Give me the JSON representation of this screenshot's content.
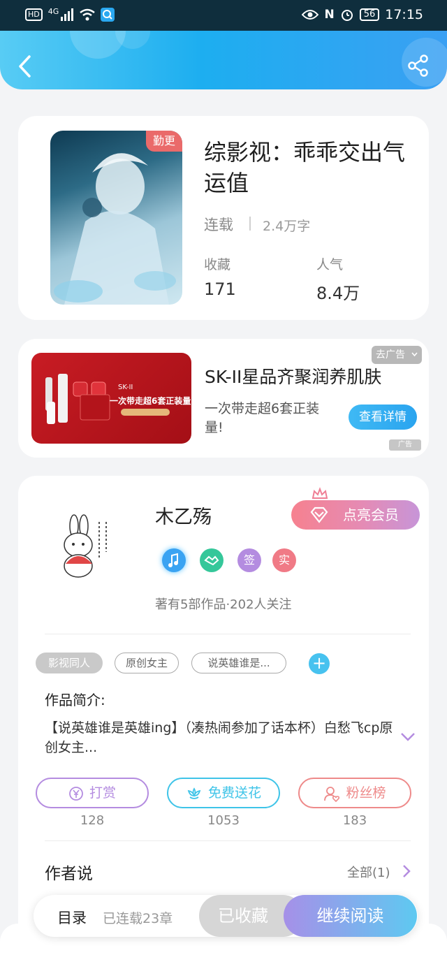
{
  "status_bar": {
    "hd": "HD",
    "net": "4G",
    "battery": "56",
    "time": "17:15"
  },
  "book": {
    "tag": "勤更",
    "title": "综影视：乖乖交出气运值",
    "status": "连载",
    "words": "2.4万字",
    "stats": [
      {
        "label": "收藏",
        "value": "171"
      },
      {
        "label": "人气",
        "value": "8.4万"
      }
    ]
  },
  "ad": {
    "title": "SK-II星品齐聚润养肌肤",
    "desc": "一次带走超6套正装量!",
    "button": "查看详情",
    "close_label": "去广告",
    "ad_mark": "广告",
    "image_logo": "SK-II",
    "image_headline": "一次带走超6套正装量"
  },
  "author": {
    "name": "木乙殇",
    "vip_button": "点亮会员",
    "badges": [
      {
        "icon": "music-note-icon",
        "color": "#3aa3f2"
      },
      {
        "icon": "handshake-icon",
        "color": "#35c79a"
      },
      {
        "label": "签",
        "color": "#b48ce0"
      },
      {
        "label": "实",
        "color": "#f07a86"
      }
    ],
    "works": "著有5部作品·202人关注"
  },
  "tags": [
    "影视同人",
    "原创女主",
    "说英雄谁是..."
  ],
  "intro": {
    "title": "作品简介:",
    "text": "【说英雄谁是英雄ing】（凑热闹参加了话本杯）白愁飞cp原创女主..."
  },
  "actions": [
    {
      "label": "打赏",
      "count": "128",
      "color": "#b48ce0",
      "icon": "yuan-icon"
    },
    {
      "label": "免费送花",
      "count": "1053",
      "color": "#3fc4e8",
      "icon": "flower-icon"
    },
    {
      "label": "粉丝榜",
      "count": "183",
      "color": "#ee8a8a",
      "icon": "fans-icon"
    }
  ],
  "author_says": {
    "title": "作者说",
    "all": "全部(1)"
  },
  "bottom_bar": {
    "toc": "目录",
    "chapters": "已连载23章",
    "favorited": "已收藏",
    "continue": "继续阅读"
  }
}
